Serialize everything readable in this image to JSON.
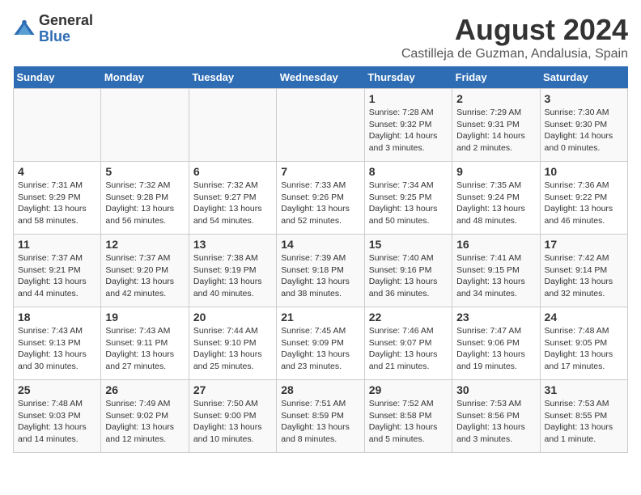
{
  "logo": {
    "general": "General",
    "blue": "Blue"
  },
  "title": "August 2024",
  "subtitle": "Castilleja de Guzman, Andalusia, Spain",
  "days": [
    "Sunday",
    "Monday",
    "Tuesday",
    "Wednesday",
    "Thursday",
    "Friday",
    "Saturday"
  ],
  "weeks": [
    [
      {
        "date": "",
        "info": ""
      },
      {
        "date": "",
        "info": ""
      },
      {
        "date": "",
        "info": ""
      },
      {
        "date": "",
        "info": ""
      },
      {
        "date": "1",
        "info": "Sunrise: 7:28 AM\nSunset: 9:32 PM\nDaylight: 14 hours and 3 minutes."
      },
      {
        "date": "2",
        "info": "Sunrise: 7:29 AM\nSunset: 9:31 PM\nDaylight: 14 hours and 2 minutes."
      },
      {
        "date": "3",
        "info": "Sunrise: 7:30 AM\nSunset: 9:30 PM\nDaylight: 14 hours and 0 minutes."
      }
    ],
    [
      {
        "date": "4",
        "info": "Sunrise: 7:31 AM\nSunset: 9:29 PM\nDaylight: 13 hours and 58 minutes."
      },
      {
        "date": "5",
        "info": "Sunrise: 7:32 AM\nSunset: 9:28 PM\nDaylight: 13 hours and 56 minutes."
      },
      {
        "date": "6",
        "info": "Sunrise: 7:32 AM\nSunset: 9:27 PM\nDaylight: 13 hours and 54 minutes."
      },
      {
        "date": "7",
        "info": "Sunrise: 7:33 AM\nSunset: 9:26 PM\nDaylight: 13 hours and 52 minutes."
      },
      {
        "date": "8",
        "info": "Sunrise: 7:34 AM\nSunset: 9:25 PM\nDaylight: 13 hours and 50 minutes."
      },
      {
        "date": "9",
        "info": "Sunrise: 7:35 AM\nSunset: 9:24 PM\nDaylight: 13 hours and 48 minutes."
      },
      {
        "date": "10",
        "info": "Sunrise: 7:36 AM\nSunset: 9:22 PM\nDaylight: 13 hours and 46 minutes."
      }
    ],
    [
      {
        "date": "11",
        "info": "Sunrise: 7:37 AM\nSunset: 9:21 PM\nDaylight: 13 hours and 44 minutes."
      },
      {
        "date": "12",
        "info": "Sunrise: 7:37 AM\nSunset: 9:20 PM\nDaylight: 13 hours and 42 minutes."
      },
      {
        "date": "13",
        "info": "Sunrise: 7:38 AM\nSunset: 9:19 PM\nDaylight: 13 hours and 40 minutes."
      },
      {
        "date": "14",
        "info": "Sunrise: 7:39 AM\nSunset: 9:18 PM\nDaylight: 13 hours and 38 minutes."
      },
      {
        "date": "15",
        "info": "Sunrise: 7:40 AM\nSunset: 9:16 PM\nDaylight: 13 hours and 36 minutes."
      },
      {
        "date": "16",
        "info": "Sunrise: 7:41 AM\nSunset: 9:15 PM\nDaylight: 13 hours and 34 minutes."
      },
      {
        "date": "17",
        "info": "Sunrise: 7:42 AM\nSunset: 9:14 PM\nDaylight: 13 hours and 32 minutes."
      }
    ],
    [
      {
        "date": "18",
        "info": "Sunrise: 7:43 AM\nSunset: 9:13 PM\nDaylight: 13 hours and 30 minutes."
      },
      {
        "date": "19",
        "info": "Sunrise: 7:43 AM\nSunset: 9:11 PM\nDaylight: 13 hours and 27 minutes."
      },
      {
        "date": "20",
        "info": "Sunrise: 7:44 AM\nSunset: 9:10 PM\nDaylight: 13 hours and 25 minutes."
      },
      {
        "date": "21",
        "info": "Sunrise: 7:45 AM\nSunset: 9:09 PM\nDaylight: 13 hours and 23 minutes."
      },
      {
        "date": "22",
        "info": "Sunrise: 7:46 AM\nSunset: 9:07 PM\nDaylight: 13 hours and 21 minutes."
      },
      {
        "date": "23",
        "info": "Sunrise: 7:47 AM\nSunset: 9:06 PM\nDaylight: 13 hours and 19 minutes."
      },
      {
        "date": "24",
        "info": "Sunrise: 7:48 AM\nSunset: 9:05 PM\nDaylight: 13 hours and 17 minutes."
      }
    ],
    [
      {
        "date": "25",
        "info": "Sunrise: 7:48 AM\nSunset: 9:03 PM\nDaylight: 13 hours and 14 minutes."
      },
      {
        "date": "26",
        "info": "Sunrise: 7:49 AM\nSunset: 9:02 PM\nDaylight: 13 hours and 12 minutes."
      },
      {
        "date": "27",
        "info": "Sunrise: 7:50 AM\nSunset: 9:00 PM\nDaylight: 13 hours and 10 minutes."
      },
      {
        "date": "28",
        "info": "Sunrise: 7:51 AM\nSunset: 8:59 PM\nDaylight: 13 hours and 8 minutes."
      },
      {
        "date": "29",
        "info": "Sunrise: 7:52 AM\nSunset: 8:58 PM\nDaylight: 13 hours and 5 minutes."
      },
      {
        "date": "30",
        "info": "Sunrise: 7:53 AM\nSunset: 8:56 PM\nDaylight: 13 hours and 3 minutes."
      },
      {
        "date": "31",
        "info": "Sunrise: 7:53 AM\nSunset: 8:55 PM\nDaylight: 13 hours and 1 minute."
      }
    ]
  ]
}
